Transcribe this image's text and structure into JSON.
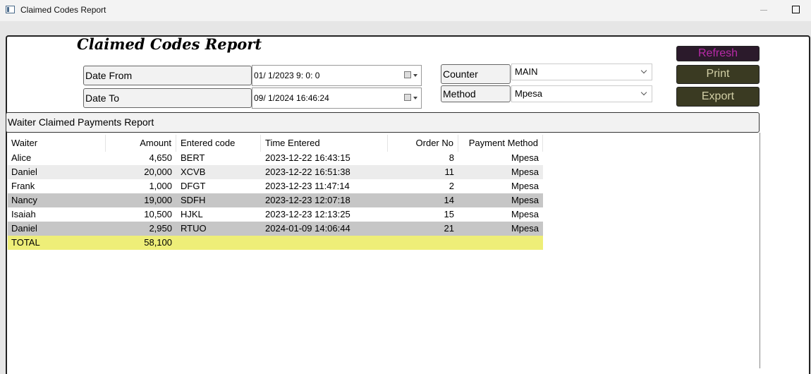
{
  "window": {
    "title": "Claimed Codes Report"
  },
  "report": {
    "title": "Claimed Codes Report"
  },
  "filters": {
    "date_from_label": "Date From",
    "date_from_value": "01/ 1/2023  9:  0:  0",
    "date_to_label": "Date To",
    "date_to_value": "09/ 1/2024 16:46:24",
    "counter_label": "Counter",
    "counter_value": "MAIN",
    "method_label": "Method",
    "method_value": "Mpesa"
  },
  "actions": {
    "refresh": "Refresh",
    "print": "Print",
    "export": "Export"
  },
  "section": {
    "title": "Waiter Claimed Payments Report"
  },
  "table": {
    "columns": [
      "Waiter",
      "Amount",
      "Entered code",
      "Time Entered",
      "Order No",
      "Payment Method"
    ],
    "rows": [
      {
        "waiter": "Alice",
        "amount": "4,650",
        "code": "BERT",
        "time": "2023-12-22 16:43:15",
        "order": "8",
        "method": "Mpesa"
      },
      {
        "waiter": "Daniel",
        "amount": "20,000",
        "code": "XCVB",
        "time": "2023-12-22 16:51:38",
        "order": "11",
        "method": "Mpesa"
      },
      {
        "waiter": "Frank",
        "amount": "1,000",
        "code": "DFGT",
        "time": "2023-12-23 11:47:14",
        "order": "2",
        "method": "Mpesa"
      },
      {
        "waiter": "Nancy",
        "amount": "19,000",
        "code": "SDFH",
        "time": "2023-12-23 12:07:18",
        "order": "14",
        "method": "Mpesa"
      },
      {
        "waiter": "Isaiah",
        "amount": "10,500",
        "code": "HJKL",
        "time": "2023-12-23 12:13:25",
        "order": "15",
        "method": "Mpesa"
      },
      {
        "waiter": "Daniel",
        "amount": "2,950",
        "code": "RTUO",
        "time": "2024-01-09 14:06:44",
        "order": "21",
        "method": "Mpesa"
      }
    ],
    "total": {
      "label": "TOTAL",
      "amount": "58,100"
    }
  },
  "colors": {
    "total_row": "#eeee78",
    "button_dark": "#3a3a22",
    "refresh_text": "#b82aa8"
  }
}
